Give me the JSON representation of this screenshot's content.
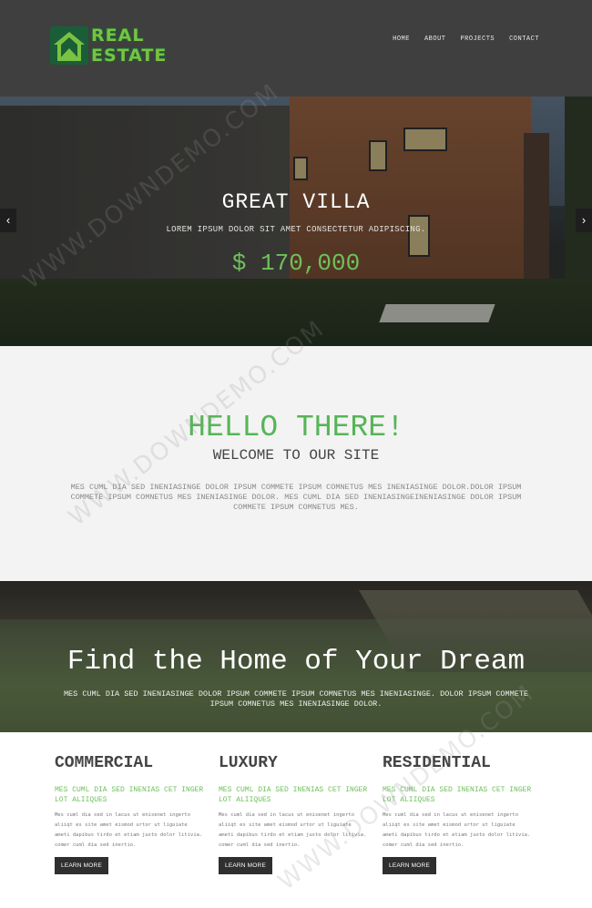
{
  "brand": {
    "logo_line1": "REAL",
    "logo_line2": "ESTATE",
    "colors": {
      "green": "#7bc142",
      "dark_green": "#1a5e37",
      "header_bg": "#3f3f3f"
    }
  },
  "nav": {
    "items": [
      {
        "label": "HOME"
      },
      {
        "label": "ABOUT"
      },
      {
        "label": "PROJECTS"
      },
      {
        "label": "CONTACT"
      }
    ]
  },
  "hero": {
    "title": "GREAT VILLA",
    "subtitle": "LOREM IPSUM DOLOR SIT AMET CONSECTETUR ADIPISCING.",
    "price": "$ 170,000",
    "prev_icon": "chevron-left-icon",
    "next_icon": "chevron-right-icon"
  },
  "welcome": {
    "heading": "HELLO THERE!",
    "subheading": "WELCOME TO OUR SITE",
    "paragraph": "MES CUML DIA SED INENIASINGE DOLOR IPSUM COMMETE IPSUM COMNETUS MES INENIASINGE DOLOR.DOLOR IPSUM COMMETE IPSUM COMNETUS MES INENIASINGE DOLOR. MES CUML DIA SED INENIASINGEINENIASINGE DOLOR IPSUM COMMETE IPSUM COMNETUS MES."
  },
  "dream": {
    "heading": "Find the Home of Your Dream",
    "paragraph": "MES CUML DIA SED INENIASINGE DOLOR IPSUM COMMETE IPSUM COMNETUS MES INENIASINGE. DOLOR IPSUM COMMETE IPSUM COMNETUS MES INENIASINGE DOLOR."
  },
  "columns": [
    {
      "title": "COMMERCIAL",
      "highlight": "MES CUML DIA SED INENIAS CET INGER LOT ALIIQUES",
      "text": "Mes cuml dia sed in lacus ut enisenet ingerto aliiqt es site amet eismod urtor ut liguiate ameti dapibus tirdo et etiam justo dolor litivia. comer cuml dia sed inertio.",
      "button": "LEARN MORE"
    },
    {
      "title": "LUXURY",
      "highlight": "MES CUML DIA SED INENIAS CET INGER LOT ALIIQUES",
      "text": "Mes cuml dia sed in lacus ut enisenet ingerto aliiqt es site amet eismod urtor ut liguiate ameti dapibus tirdo et etiam justo dolor litivia. comer cuml dia sed inertio.",
      "button": "LEARN MORE"
    },
    {
      "title": "RESIDENTIAL",
      "highlight": "MES CUML DIA SED INENIAS CET INGER LOT ALIIQUES",
      "text": "Mes cuml dia sed in lacus ut enisenet ingerto aliiqt es site amet eismod urtor ut liguiate ameti dapibus tirdo et etiam justo dolor litivia. comer cuml dia sed inertio.",
      "button": "LEARN MORE"
    }
  ],
  "watermark": "WWW.DOWNDEMO.COM"
}
